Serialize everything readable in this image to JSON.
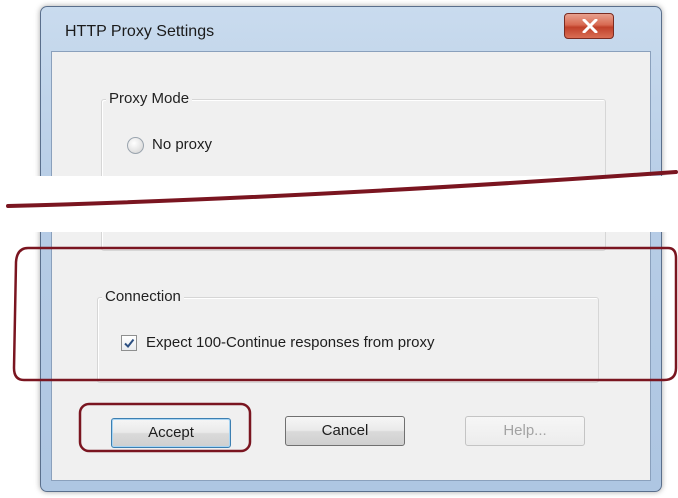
{
  "window": {
    "title": "HTTP Proxy Settings",
    "close_icon": "close-x-icon"
  },
  "proxy_mode": {
    "legend": "Proxy Mode",
    "options": [
      {
        "label": "No proxy",
        "selected": false
      }
    ]
  },
  "connection": {
    "legend": "Connection",
    "expect_continue": {
      "label": "Expect 100-Continue responses from proxy",
      "checked": true
    }
  },
  "buttons": {
    "accept": "Accept",
    "cancel": "Cancel",
    "help": "Help..."
  },
  "annotation_color": "#7a1520"
}
